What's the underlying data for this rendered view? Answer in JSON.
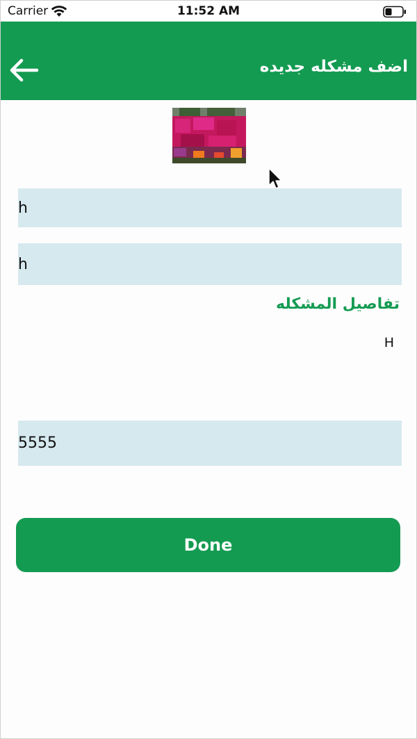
{
  "status_bar": {
    "carrier": "Carrier",
    "time": "11:52 AM"
  },
  "header": {
    "title": "اضف مشكله جديده",
    "back_icon": "arrow-left-icon",
    "background_color": "#149b52"
  },
  "form": {
    "field_1_value": "h",
    "field_2_value": "h",
    "details_label": "تفاصيل المشكله",
    "details_value": "H",
    "field_3_value": "5555"
  },
  "actions": {
    "done_label": "Done"
  },
  "colors": {
    "accent": "#149b52",
    "field_background": "#d6e9ef"
  }
}
